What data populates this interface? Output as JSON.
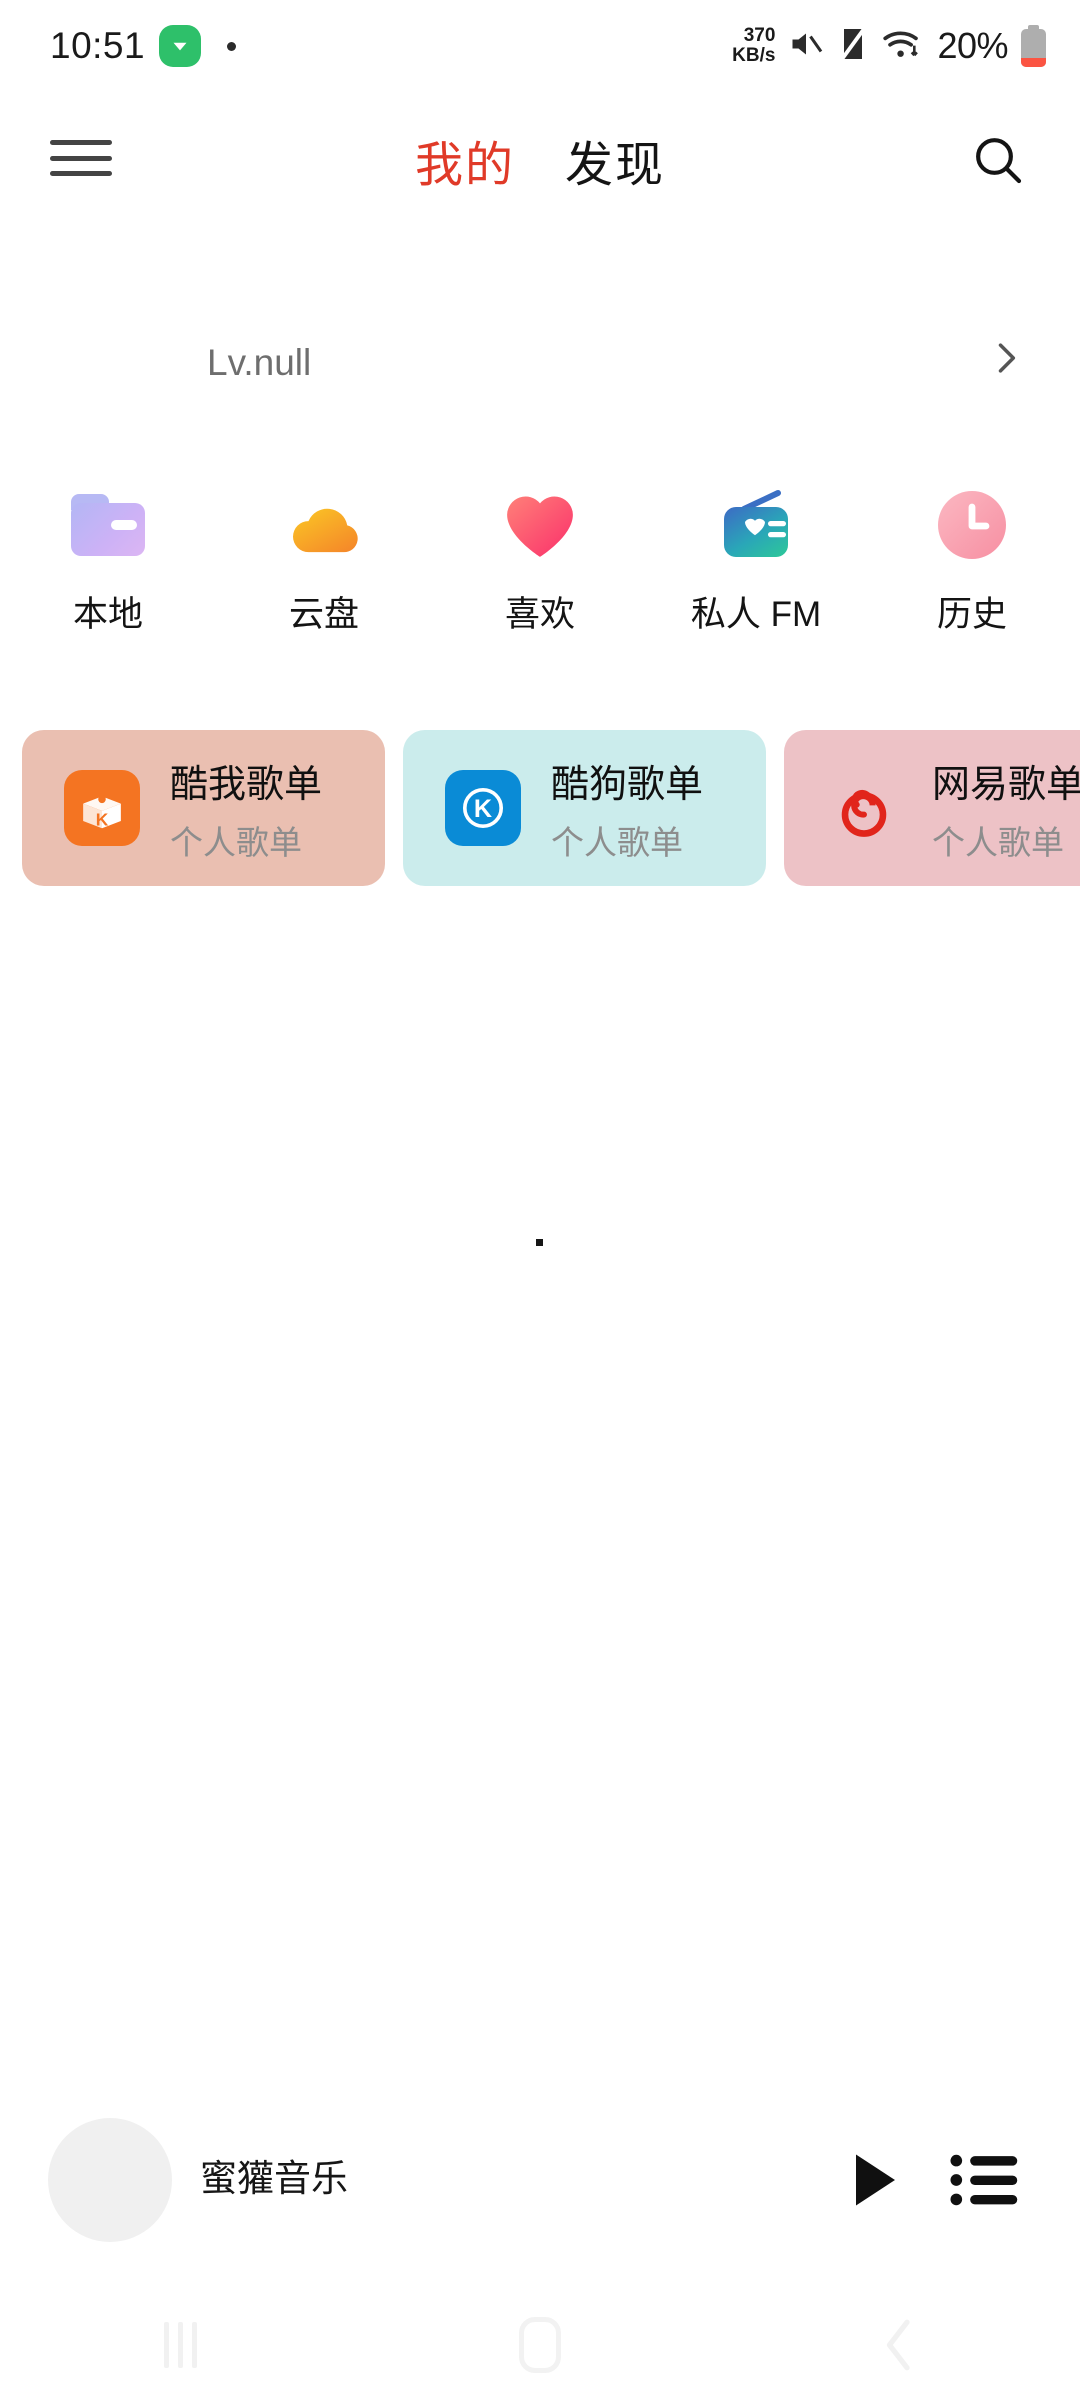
{
  "status_bar": {
    "time": "10:51",
    "badge_icon": "chevron-down-badge-icon",
    "badge_color": "#2ec06a",
    "dot_indicator": "·",
    "network_speed_value": "370",
    "network_speed_unit": "KB/s",
    "mute_icon": "mute-icon",
    "vibrate_off_icon": "vibrate-off-icon",
    "wifi_icon": "wifi-icon",
    "battery_percent": "20%",
    "battery_level_color": "#fb5442"
  },
  "header": {
    "menu_icon": "hamburger-menu-icon",
    "tabs": [
      {
        "label": "我的",
        "active": true
      },
      {
        "label": "发现",
        "active": false
      }
    ],
    "active_tab_color": "#e03a28",
    "search_icon": "search-icon"
  },
  "profile": {
    "level_text": "Lv.null",
    "chevron_icon": "chevron-right-icon"
  },
  "quick_access": [
    {
      "label": "本地",
      "icon": "folder-icon",
      "color": "#c0b4f5"
    },
    {
      "label": "云盘",
      "icon": "cloud-icon",
      "color": "#f7b733"
    },
    {
      "label": "喜欢",
      "icon": "heart-icon",
      "color": "#fa3c6e"
    },
    {
      "label": "私人 FM",
      "icon": "radio-icon",
      "color": "#2ebfa5"
    },
    {
      "label": "历史",
      "icon": "clock-icon",
      "color": "#f9a0b0"
    }
  ],
  "playlist_cards": [
    {
      "title": "酷我歌单",
      "subtitle": "个人歌单",
      "icon": "kuwo-logo-icon",
      "bg": "#eabfb1",
      "icon_bg": "#f47422"
    },
    {
      "title": "酷狗歌单",
      "subtitle": "个人歌单",
      "icon": "kugou-logo-icon",
      "bg": "#cbecec",
      "icon_bg": "#0a8bd6"
    },
    {
      "title": "网易歌单",
      "subtitle": "个人歌单",
      "icon": "netease-logo-icon",
      "bg": "#edc2c6",
      "icon_bg": "#e1251b"
    }
  ],
  "mini_player": {
    "album_art": "album-art-placeholder",
    "track_title": "蜜獾音乐",
    "play_icon": "play-icon",
    "playlist_icon": "playlist-icon"
  },
  "nav_bar": {
    "recents_icon": "recents-icon",
    "home_icon": "home-icon",
    "back_icon": "back-icon"
  }
}
